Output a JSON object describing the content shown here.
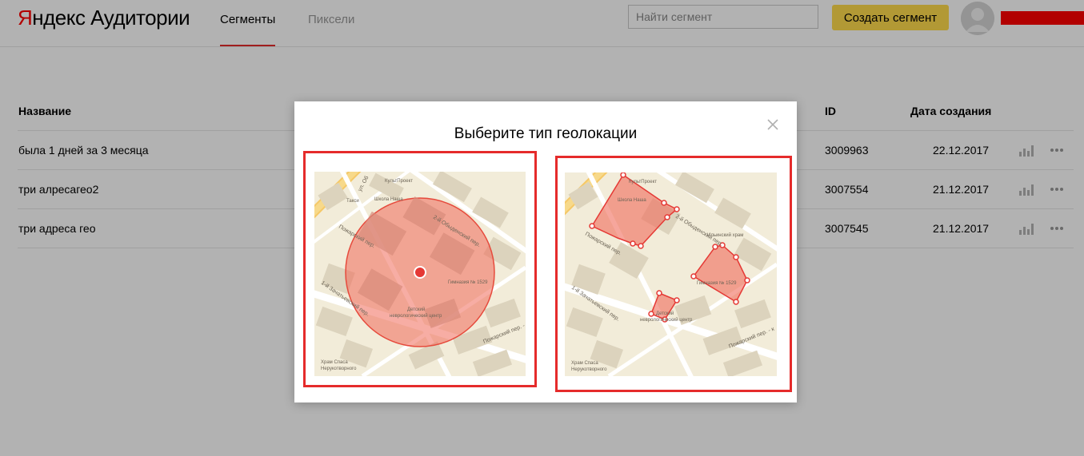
{
  "header": {
    "logo_part1": "Я",
    "logo_part2": "ндекс",
    "logo_part3": "Аудитории",
    "tabs": [
      {
        "label": "Сегменты",
        "active": true
      },
      {
        "label": "Пиксели",
        "active": false
      }
    ],
    "search_placeholder": "Найти сегмент",
    "create_button": "Создать сегмент",
    "avatar_icon": "user-avatar-icon"
  },
  "table": {
    "columns": [
      "Название",
      "ID",
      "Дата создания"
    ],
    "rows": [
      {
        "name": "была 1 дней за 3 месяца",
        "id": "3009963",
        "date": "22.12.2017"
      },
      {
        "name": "три алресагео2",
        "id": "3007554",
        "date": "21.12.2017"
      },
      {
        "name": "три адреса гео",
        "id": "3007545",
        "date": "21.12.2017"
      }
    ]
  },
  "modal": {
    "title": "Выберите тип геолокации",
    "close_icon": "close-icon",
    "options": [
      {
        "type": "circle",
        "icon": "radius-map-icon"
      },
      {
        "type": "polygon",
        "icon": "polygon-map-icon"
      }
    ],
    "map_labels": {
      "street_ob": "ул. Об",
      "culturproject": "КультПроект",
      "school": "Школа Наша",
      "taxi": "Такси",
      "obydensky": "2-й Обыденский пер.",
      "ilinsky": "Ильинский храм",
      "pozharsky": "Пожарский пер.",
      "gymnasium": "Гимназия № 1529",
      "children": "Детский",
      "neuro": "неврологический центр",
      "zachatievsky": "1-й Зачатьевский пер.",
      "pozharsky_pe": "Пожарский пер. - к",
      "spasa": "Храм Спаса",
      "nerukotvorny": "Нерукотворного"
    }
  },
  "colors": {
    "accent_red": "#e52b2b",
    "button_yellow": "#ffdb4d",
    "map_bg": "#f2ecd9",
    "map_zone": "#f06a5a"
  }
}
